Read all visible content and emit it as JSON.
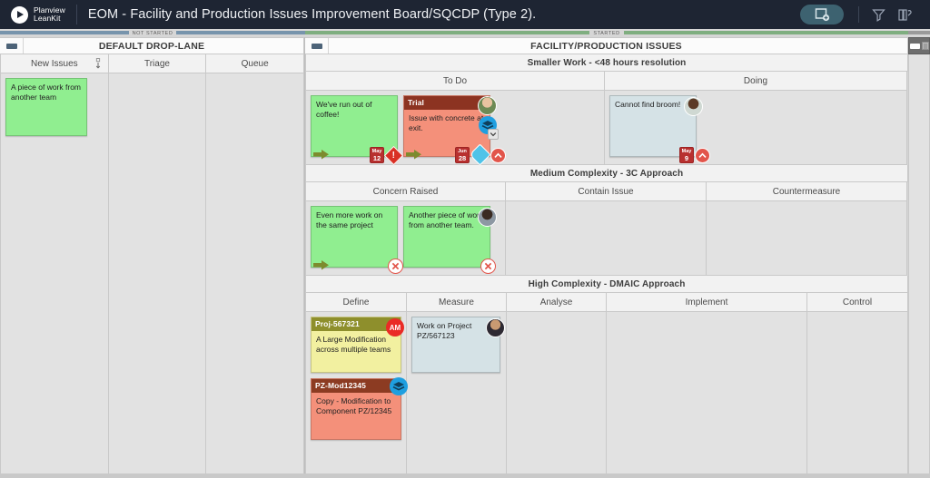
{
  "topbar": {
    "brand_line1": "Planview",
    "brand_line2": "LeanKit",
    "board_title": "EOM - Facility and Production Issues Improvement Board/SQCDP (Type 2).",
    "add_card_icon": "add-card-icon",
    "filter_icon": "filter-funnel-icon",
    "board_layout_icon": "board-layout-icon",
    "accent_color": "#3d6270",
    "background_color": "#1e2533"
  },
  "status_strips": [
    {
      "label": "NOT STARTED",
      "color": "#7794ac"
    },
    {
      "label": "STARTED",
      "color": "#7fae80"
    }
  ],
  "lanes": {
    "not_started": {
      "title": "DEFAULT DROP-LANE",
      "collapse_icon": "collapse-lane-icon",
      "columns": [
        {
          "label": "New Issues",
          "sort_icon": "sort-arrow-icon"
        },
        {
          "label": "Triage"
        },
        {
          "label": "Queue"
        }
      ],
      "cards": {
        "new_issues": [
          {
            "title": "A piece of work from another team",
            "color": "green",
            "header": null
          }
        ],
        "triage": [],
        "queue": []
      }
    },
    "started": {
      "title": "FACILITY/PRODUCTION ISSUES",
      "collapse_icon": "collapse-lane-icon",
      "groups": [
        {
          "title": "Smaller Work - <48 hours resolution",
          "columns": [
            {
              "label": "To Do"
            },
            {
              "label": "Doing"
            }
          ],
          "cards": {
            "to_do": [
              {
                "header": null,
                "title": "We've run out of coffee!",
                "color": "green",
                "moved_icon": "moved-arrow-icon",
                "date": {
                  "month": "May",
                  "day": "12"
                },
                "badges": [
                  "blocked-diamond-icon"
                ]
              },
              {
                "header": "Trial",
                "header_color": "#8c3321",
                "title": "Issue with concrete at exit.",
                "color": "salmon",
                "avatar": "avatar-photo",
                "connection_icon": "connected-cards-icon",
                "moved_icon": "moved-arrow-icon",
                "date": {
                  "month": "Jun",
                  "day": "28"
                },
                "badges": [
                  "tag-icon",
                  "priority-up-icon"
                ]
              }
            ],
            "doing": [
              {
                "header": null,
                "title": "Cannot find broom!",
                "color": "blue",
                "avatar": "avatar-photo",
                "date": {
                  "month": "May",
                  "day": "9"
                },
                "badges": [
                  "priority-up-icon"
                ]
              }
            ]
          }
        },
        {
          "title": "Medium Complexity - 3C Approach",
          "columns": [
            {
              "label": "Concern Raised"
            },
            {
              "label": "Contain Issue"
            },
            {
              "label": "Countermeasure"
            }
          ],
          "cards": {
            "concern_raised": [
              {
                "header": null,
                "title": "Even more work on the same project",
                "color": "green",
                "moved_icon": "moved-arrow-icon",
                "badges": [
                  "blocked-x-icon"
                ]
              },
              {
                "header": null,
                "title": "Another piece of work from another team.",
                "color": "green",
                "avatar": "avatar-photo",
                "badges": [
                  "blocked-x-icon"
                ]
              }
            ],
            "contain_issue": [],
            "countermeasure": []
          }
        },
        {
          "title": "High Complexity - DMAIC Approach",
          "columns": [
            {
              "label": "Define"
            },
            {
              "label": "Measure"
            },
            {
              "label": "Analyse"
            },
            {
              "label": "Implement"
            },
            {
              "label": "Control"
            }
          ],
          "cards": {
            "define": [
              {
                "header": "Proj-567321",
                "header_color": "#8e8f2c",
                "title": "A Large Modification across multiple teams",
                "color": "yellow",
                "avatar_initials": "AM"
              },
              {
                "header": "PZ-Mod12345",
                "header_color": "#8c3b22",
                "title": "Copy - Modification to Component PZ/12345",
                "color": "salmon",
                "connection_icon": "connected-cards-icon"
              }
            ],
            "measure": [
              {
                "header": null,
                "title": "Work on Project PZ/567123",
                "color": "blue",
                "avatar": "avatar-photo"
              }
            ],
            "analyse": [],
            "implement": [],
            "control": []
          }
        }
      ]
    },
    "collapsed_lane": {
      "collapse_icon": "collapse-lane-icon",
      "menu_icon": "lane-menu-icon"
    }
  }
}
